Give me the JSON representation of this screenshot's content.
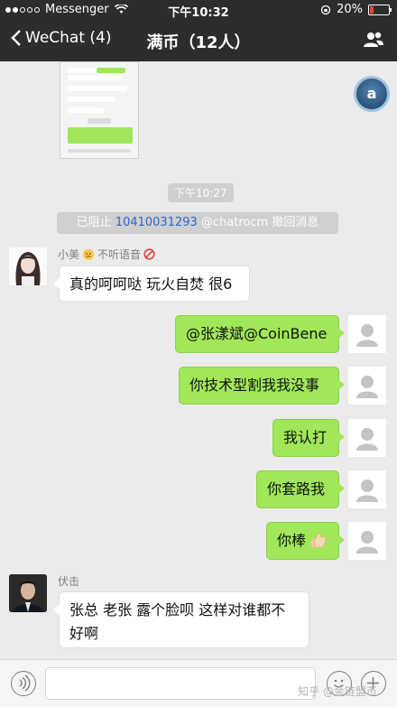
{
  "status_bar": {
    "carrier": "Messenger",
    "time": "下午10:32",
    "battery": "20%"
  },
  "nav": {
    "back_label": "WeChat (4)",
    "title": "满币（12人）"
  },
  "chat": {
    "time_divider": "下午10:27",
    "recall_notice": {
      "prefix": "已阻止 ",
      "number": "10410031293",
      "suffix": " @chatrocm 撤回消息"
    },
    "messages": [
      {
        "side": "in",
        "sender": "小美",
        "sender_suffix": "不听语音",
        "text": "真的呵呵哒 玩火自焚 很6"
      },
      {
        "side": "out",
        "text": "@张漾斌@CoinBene"
      },
      {
        "side": "out",
        "text": "你技术型割我我没事"
      },
      {
        "side": "out",
        "text": "我认打"
      },
      {
        "side": "out",
        "text": "你套路我"
      },
      {
        "side": "out",
        "text": "你棒"
      },
      {
        "side": "in",
        "sender": "伏击",
        "text_line1": "张总 老张 露个脸呗 这样对谁都不",
        "text_line2": "好啊"
      }
    ]
  },
  "watermark": "知乎 @金链盟币",
  "colors": {
    "header_bg": "#2d2d2f",
    "chat_bg": "#ebebeb",
    "outgoing_bubble": "#a0e759",
    "incoming_bubble": "#ffffff",
    "link_number": "#2e67c9"
  },
  "icons": {
    "back": "chevron-left-icon",
    "group_members": "people-icon",
    "voice": "voice-icon",
    "emoji": "emoji-icon",
    "plus": "plus-icon",
    "wifi": "wifi-icon",
    "thumbs_up": "thumbs-up-icon"
  }
}
